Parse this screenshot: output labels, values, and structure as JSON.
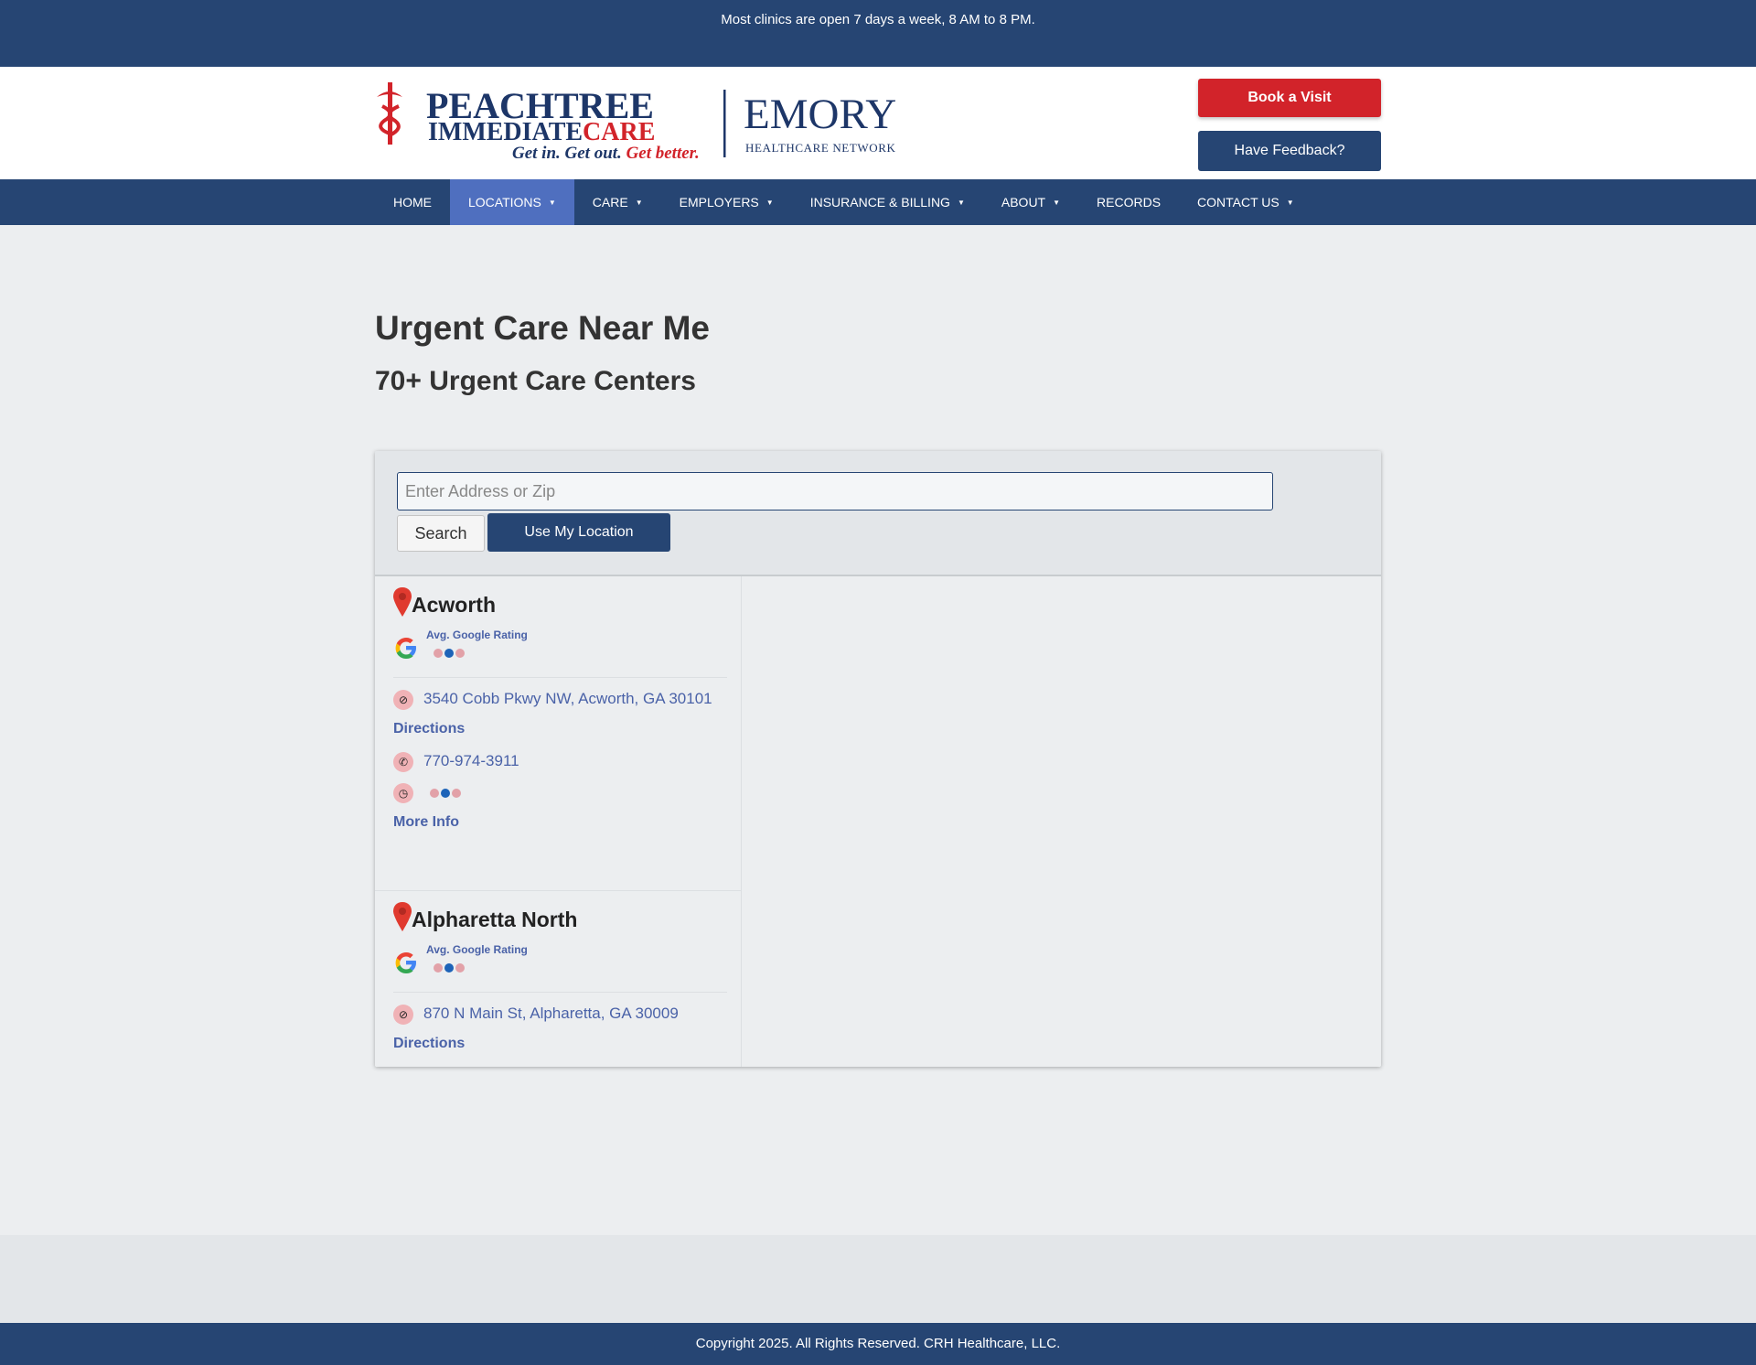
{
  "topbar": {
    "message": "Most clinics are open 7 days a week, 8 AM to 8 PM."
  },
  "header": {
    "logo": {
      "brand_line1": "PEACHTREE",
      "brand_line2a": "IMMEDIATE",
      "brand_line2b": "CARE",
      "tagline_a": "Get in. Get out.",
      "tagline_b": "Get better.",
      "partner_name": "EMORY",
      "partner_sub": "HEALTHCARE NETWORK"
    },
    "book_button": "Book a Visit",
    "feedback_button": "Have Feedback?"
  },
  "nav": {
    "items": [
      {
        "label": "HOME",
        "dropdown": false
      },
      {
        "label": "LOCATIONS",
        "dropdown": true,
        "active": true
      },
      {
        "label": "CARE",
        "dropdown": true
      },
      {
        "label": "EMPLOYERS",
        "dropdown": true
      },
      {
        "label": "INSURANCE & BILLING",
        "dropdown": true
      },
      {
        "label": "ABOUT",
        "dropdown": true
      },
      {
        "label": "RECORDS",
        "dropdown": false
      },
      {
        "label": "CONTACT US",
        "dropdown": true
      }
    ],
    "caret_glyph": "▼"
  },
  "page": {
    "title": "Urgent Care Near Me",
    "subtitle": "70+ Urgent Care Centers"
  },
  "search": {
    "placeholder": "Enter Address or Zip",
    "value": "",
    "search_button": "Search",
    "location_button": "Use My Location"
  },
  "locations": [
    {
      "name": "Acworth",
      "rating_label": "Avg. Google Rating",
      "address": "3540 Cobb Pkwy NW, Acworth, GA 30101",
      "directions": "Directions",
      "phone": "770-974-3911",
      "more_info": "More Info"
    },
    {
      "name": "Alpharetta North",
      "rating_label": "Avg. Google Rating",
      "address": "870 N Main St, Alpharetta, GA 30009",
      "directions": "Directions"
    }
  ],
  "footer": {
    "copyright": "Copyright 2025. All Rights Reserved. CRH Healthcare, LLC."
  },
  "colors": {
    "navy": "#264573",
    "red": "#d2232a",
    "nav_active": "#4f6fbf",
    "link": "#4a62a8",
    "icon_badge": "#f0b2b6"
  }
}
